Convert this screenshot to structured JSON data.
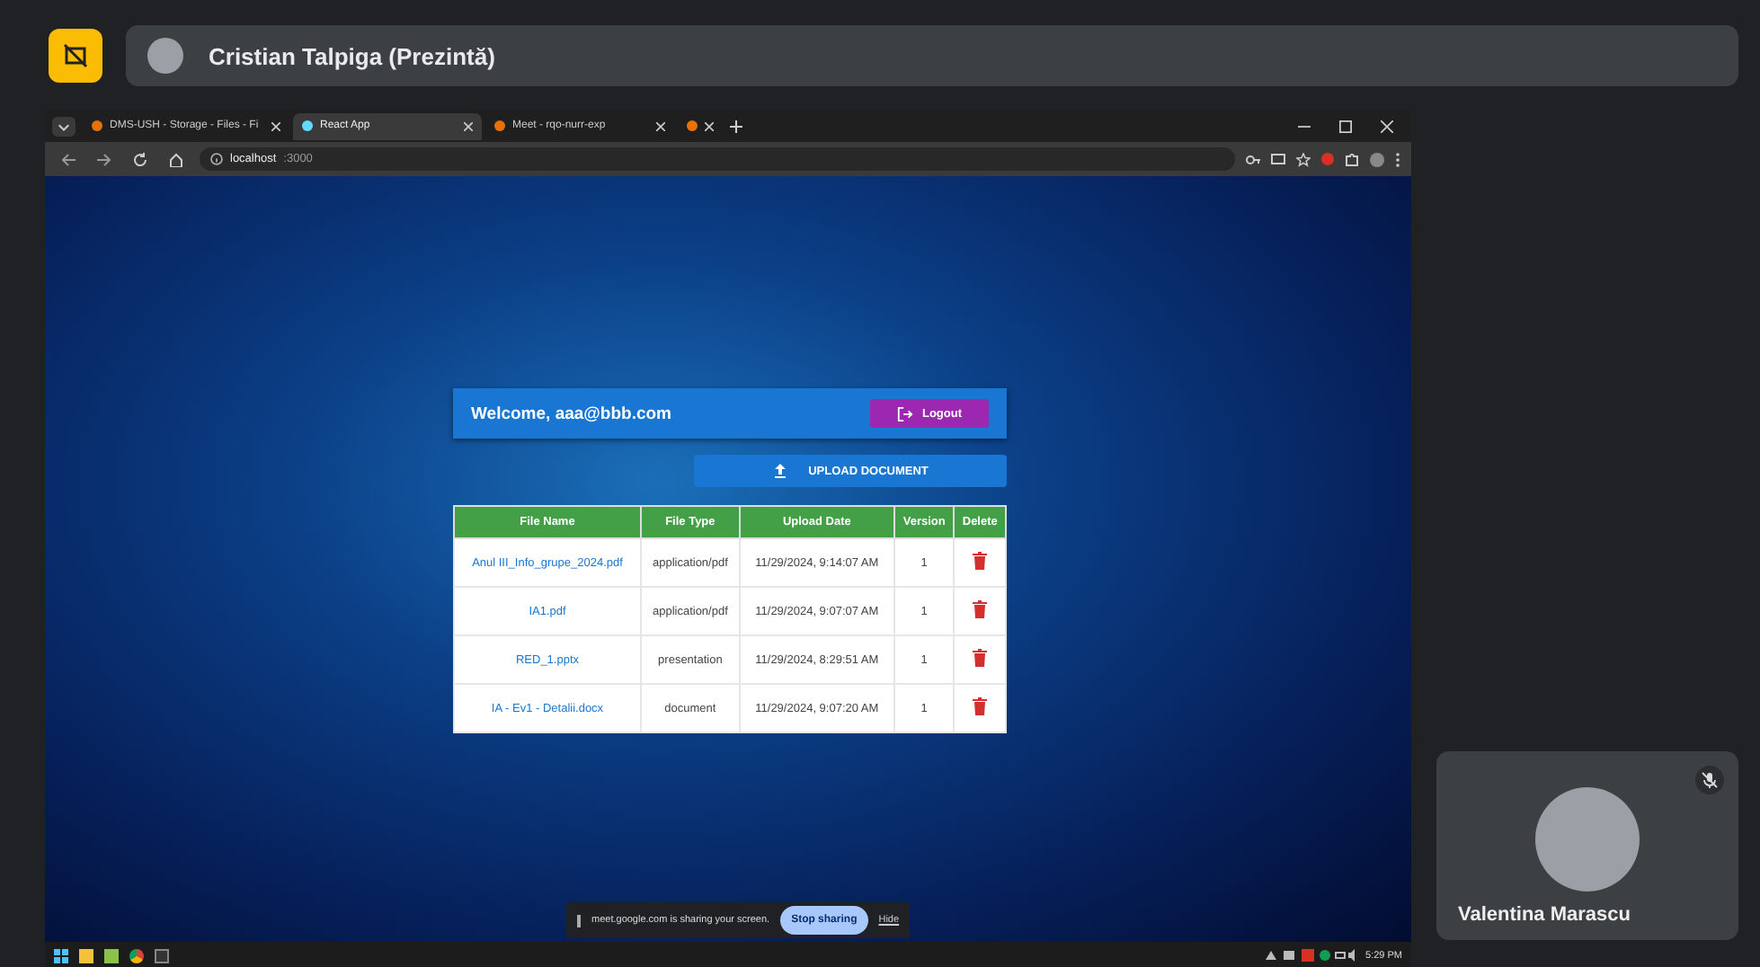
{
  "meet": {
    "presenter": "Cristian Talpiga (Prezintă)"
  },
  "browser": {
    "tabs": [
      {
        "title": "DMS-USH - Storage - Files - Fi",
        "selected": false
      },
      {
        "title": "React App",
        "selected": true
      },
      {
        "title": "Meet - rqo-nurr-exp",
        "selected": false
      },
      {
        "selected": false
      }
    ],
    "address": {
      "host": "localhost",
      "port": ":3000"
    }
  },
  "app": {
    "welcome": "Welcome, aaa@bbb.com",
    "logout": "Logout",
    "upload": "UPLOAD DOCUMENT",
    "table": {
      "columns": [
        "File Name",
        "File Type",
        "Upload Date",
        "Version",
        "Delete"
      ],
      "rows": [
        {
          "name": "Anul III_Info_grupe_2024.pdf",
          "type": "application/pdf",
          "date": "11/29/2024, 9:14:07 AM",
          "version": "1"
        },
        {
          "name": "IA1.pdf",
          "type": "application/pdf",
          "date": "11/29/2024, 9:07:07 AM",
          "version": "1"
        },
        {
          "name": "RED_1.pptx",
          "type": "presentation",
          "date": "11/29/2024, 8:29:51 AM",
          "version": "1"
        },
        {
          "name": "IA - Ev1 - Detalii.docx",
          "type": "document",
          "date": "11/29/2024, 9:07:20 AM",
          "version": "1"
        }
      ]
    }
  },
  "share_banner": {
    "text": "meet.google.com is sharing your screen.",
    "stop": "Stop sharing",
    "hide": "Hide"
  },
  "taskbar": {
    "time": "5:29 PM"
  },
  "participant": {
    "name": "Valentina Marascu",
    "muted": true
  }
}
